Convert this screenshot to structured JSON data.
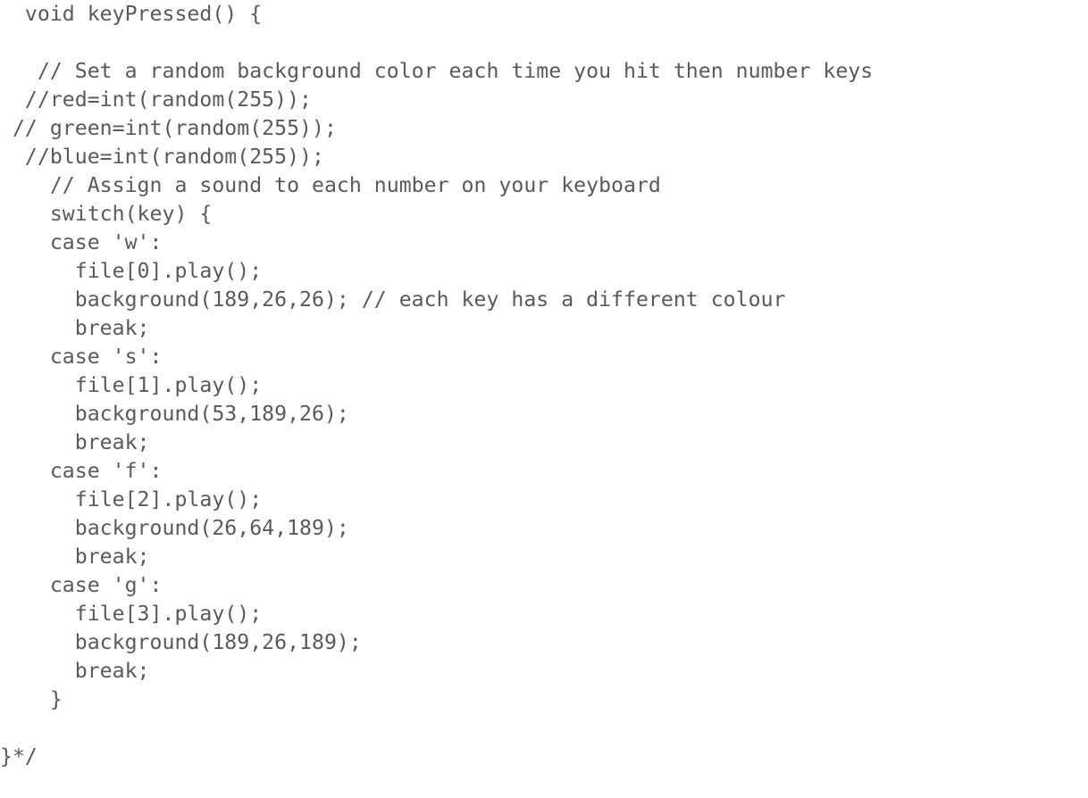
{
  "code": {
    "lines": [
      "  void keyPressed() {",
      "",
      "   // Set a random background color each time you hit then number keys",
      "  //red=int(random(255));",
      " // green=int(random(255));",
      "  //blue=int(random(255));",
      "    // Assign a sound to each number on your keyboard",
      "    switch(key) {",
      "    case 'w':",
      "      file[0].play();",
      "      background(189,26,26); // each key has a different colour",
      "      break;",
      "    case 's':",
      "      file[1].play();",
      "      background(53,189,26);",
      "      break;",
      "    case 'f':",
      "      file[2].play();",
      "      background(26,64,189);",
      "      break;",
      "    case 'g':",
      "      file[3].play();",
      "      background(189,26,189);",
      "      break;",
      "    }",
      "",
      "}*/"
    ]
  }
}
